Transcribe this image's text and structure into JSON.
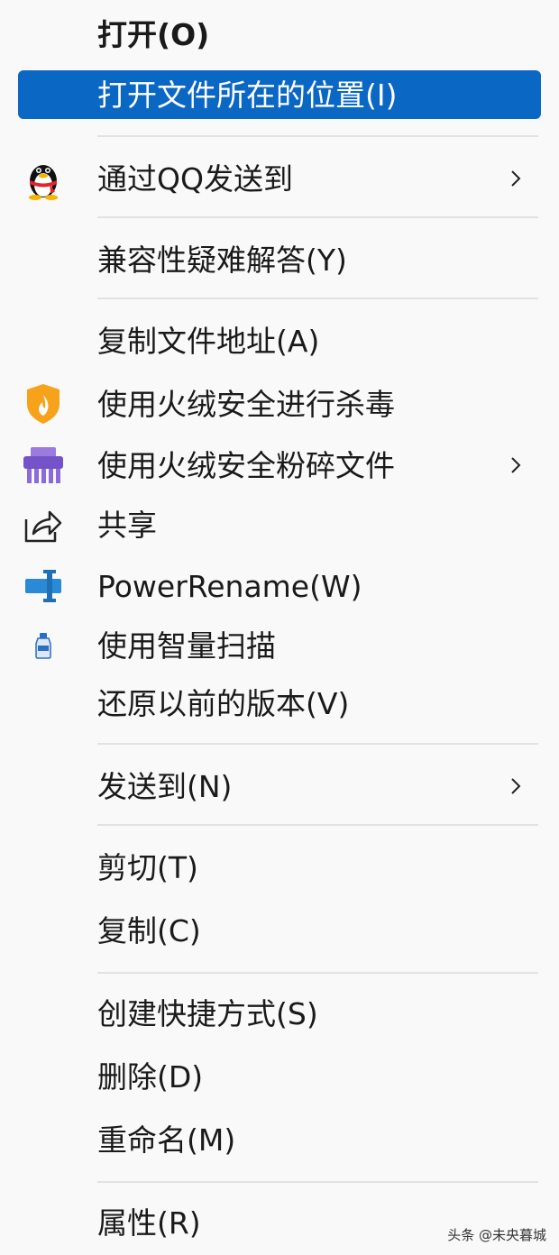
{
  "menu": {
    "items": [
      {
        "label": "打开(O)"
      },
      {
        "label": "打开文件所在的位置(I)"
      },
      {
        "label": "通过QQ发送到",
        "icon": "qq-penguin-icon",
        "submenu": true
      },
      {
        "label": "兼容性疑难解答(Y)"
      },
      {
        "label": "复制文件地址(A)"
      },
      {
        "label": "使用火绒安全进行杀毒",
        "icon": "huorong-shield-icon"
      },
      {
        "label": "使用火绒安全粉碎文件",
        "icon": "shredder-icon",
        "submenu": true
      },
      {
        "label": "共享",
        "icon": "share-icon"
      },
      {
        "label": "PowerRename(W)",
        "icon": "powerrename-icon"
      },
      {
        "label": "使用智量扫描",
        "icon": "zhiliang-bottle-icon"
      },
      {
        "label": "还原以前的版本(V)"
      },
      {
        "label": "发送到(N)",
        "submenu": true
      },
      {
        "label": "剪切(T)"
      },
      {
        "label": "复制(C)"
      },
      {
        "label": "创建快捷方式(S)"
      },
      {
        "label": "删除(D)"
      },
      {
        "label": "重命名(M)"
      },
      {
        "label": "属性(R)"
      }
    ]
  },
  "colors": {
    "highlight": "#0a67c4",
    "background": "#f9f9f9",
    "separator": "#e2e2e2"
  },
  "watermark": "头条 @未央暮城"
}
